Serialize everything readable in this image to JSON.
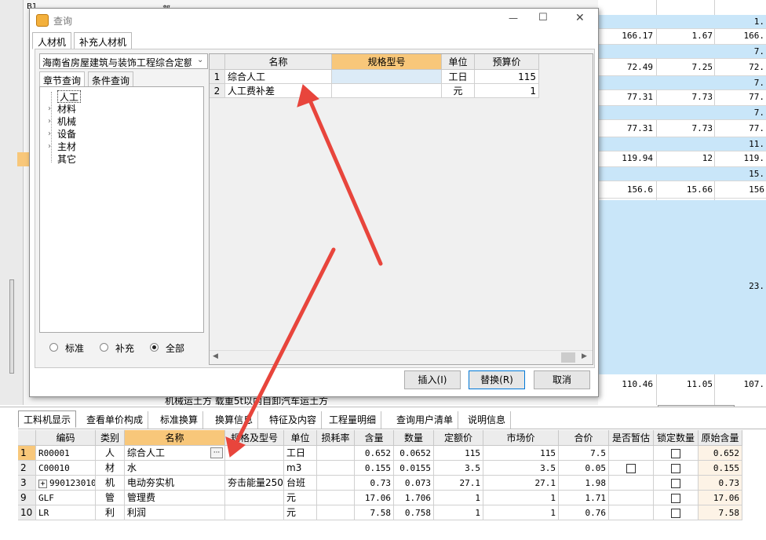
{
  "dialog": {
    "title": "查询",
    "minimize_symbol": "—",
    "maximize_symbol": "☐",
    "close_symbol": "✕",
    "tabs": [
      "人材机",
      "补充人材机"
    ],
    "quota_select": "海南省房屋建筑与装饰工程综合定额",
    "sub_tabs": [
      "章节查询",
      "条件查询"
    ],
    "tree": [
      "人工",
      "材料",
      "机械",
      "设备",
      "主材",
      "其它"
    ],
    "radios": [
      "标准",
      "补充",
      "全部"
    ],
    "grid": {
      "headers": [
        "名称",
        "规格型号",
        "单位",
        "预算价"
      ],
      "rows": [
        {
          "no": "1",
          "name": "综合人工",
          "spec": "",
          "unit": "工日",
          "price": "115"
        },
        {
          "no": "2",
          "name": "人工费补差",
          "spec": "",
          "unit": "元",
          "price": "1"
        }
      ]
    },
    "buttons": {
      "insert": "插入(I)",
      "replace": "替换(R)",
      "cancel": "取消"
    }
  },
  "background": {
    "left_markers": [
      "B1",
      "部"
    ],
    "bottom_text": "机械运土方 载重5t以内自卸汽车运土方",
    "values": [
      {
        "a": "",
        "b": "",
        "c": "1."
      },
      {
        "a": "166.17",
        "b": "1.67",
        "c": "166."
      },
      {
        "a": "",
        "b": "",
        "c": "7."
      },
      {
        "a": "72.49",
        "b": "7.25",
        "c": "72."
      },
      {
        "a": "",
        "b": "",
        "c": "7."
      },
      {
        "a": "77.31",
        "b": "7.73",
        "c": "77."
      },
      {
        "a": "",
        "b": "",
        "c": "7."
      },
      {
        "a": "77.31",
        "b": "7.73",
        "c": "77."
      },
      {
        "a": "",
        "b": "",
        "c": "11."
      },
      {
        "a": "119.94",
        "b": "12",
        "c": "119."
      },
      {
        "a": "",
        "b": "",
        "c": "15."
      },
      {
        "a": "156.6",
        "b": "15.66",
        "c": "156"
      }
    ],
    "mid_value": "23.",
    "last": {
      "a": "110.46",
      "b": "11.05",
      "c": "107."
    }
  },
  "bottom": {
    "tabs": [
      "工料机显示",
      "查看单价构成",
      "标准换算",
      "换算信息",
      "特征及内容",
      "工程量明细",
      "查询用户清单",
      "说明信息"
    ],
    "headers": [
      "编码",
      "类别",
      "名称",
      "规格及型号",
      "单位",
      "损耗率",
      "含量",
      "数量",
      "定额价",
      "市场价",
      "合价",
      "是否暂估",
      "锁定数量",
      "原始含量"
    ],
    "rows": [
      {
        "no": "1",
        "code": "R00001",
        "type": "人",
        "name": "综合人工",
        "spec": "",
        "unit": "工日",
        "loss": "",
        "content": "0.652",
        "qty": "0.0652",
        "quota": "115",
        "market": "115",
        "total": "7.5",
        "est": false,
        "lock": true,
        "orig": "0.652"
      },
      {
        "no": "2",
        "code": "C00010",
        "type": "材",
        "name": "水",
        "spec": "",
        "unit": "m3",
        "loss": "",
        "content": "0.155",
        "qty": "0.0155",
        "quota": "3.5",
        "market": "3.5",
        "total": "0.05",
        "est": true,
        "lock": true,
        "orig": "0.155"
      },
      {
        "no": "3",
        "code": "990123010",
        "type": "机",
        "name": "电动夯实机",
        "spec": "夯击能量250",
        "unit": "台班",
        "loss": "",
        "content": "0.73",
        "qty": "0.073",
        "quota": "27.1",
        "market": "27.1",
        "total": "1.98",
        "est": false,
        "lock": true,
        "orig": "0.73"
      },
      {
        "no": "9",
        "code": "GLF",
        "type": "管",
        "name": "管理费",
        "spec": "",
        "unit": "元",
        "loss": "",
        "content": "17.06",
        "qty": "1.706",
        "quota": "1",
        "market": "1",
        "total": "1.71",
        "est": false,
        "lock": true,
        "orig": "17.06"
      },
      {
        "no": "10",
        "code": "LR",
        "type": "利",
        "name": "利润",
        "spec": "",
        "unit": "元",
        "loss": "",
        "content": "7.58",
        "qty": "0.758",
        "quota": "1",
        "market": "1",
        "total": "0.76",
        "est": false,
        "lock": true,
        "orig": "7.58"
      }
    ],
    "expand_symbol": "+",
    "ellipsis": "···"
  },
  "colors": {
    "accent": "#0078d7",
    "header_orange": "#f8c77a",
    "row_blue": "#c9e6f9",
    "arrow": "#e8453c"
  }
}
